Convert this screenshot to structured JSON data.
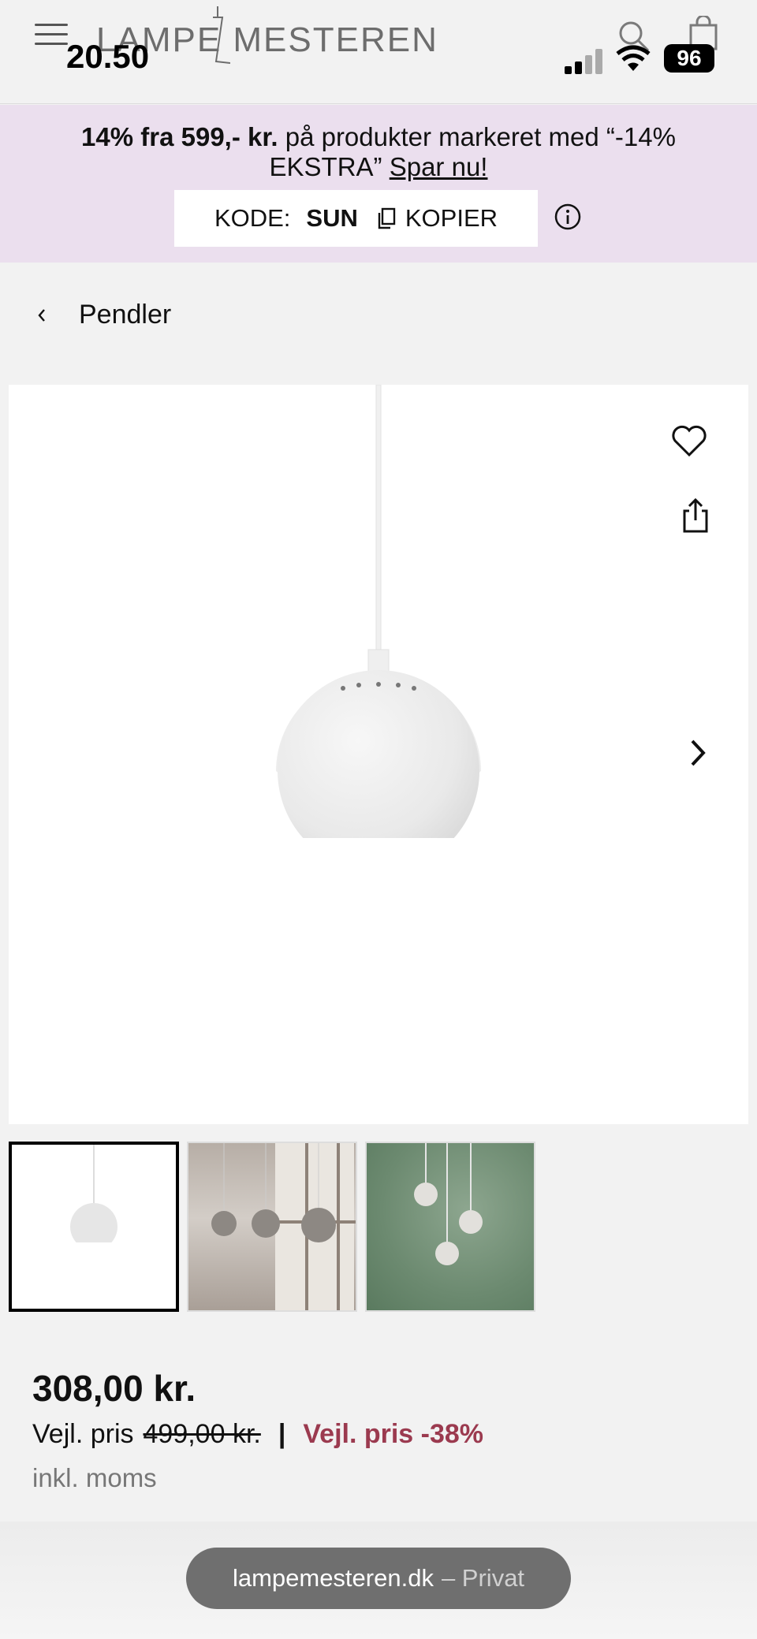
{
  "status_bar": {
    "time": "20.50",
    "battery": "96"
  },
  "header": {
    "logo_text": "LAMPE MESTEREN"
  },
  "promo": {
    "bold_text": "14% fra 599,- kr.",
    "text": " på produkter markeret med “-14% EKSTRA” ",
    "link_text": "Spar nu!",
    "code_label": "KODE:",
    "code_value": "SUN",
    "copy_label": "KOPIER"
  },
  "breadcrumb": {
    "label": "Pendler"
  },
  "product": {
    "price": "308,00 kr.",
    "rrp_label": "Vejl. pris",
    "rrp_value": "499,00 kr.",
    "separator": "|",
    "discount_label": "Vejl. pris -38%",
    "vat_note": "inkl. moms"
  },
  "browser": {
    "domain": "lampemesteren.dk",
    "mode": "– Privat"
  },
  "colors": {
    "promo_bg": "#ebdfee",
    "discount": "#9b3a4f"
  }
}
